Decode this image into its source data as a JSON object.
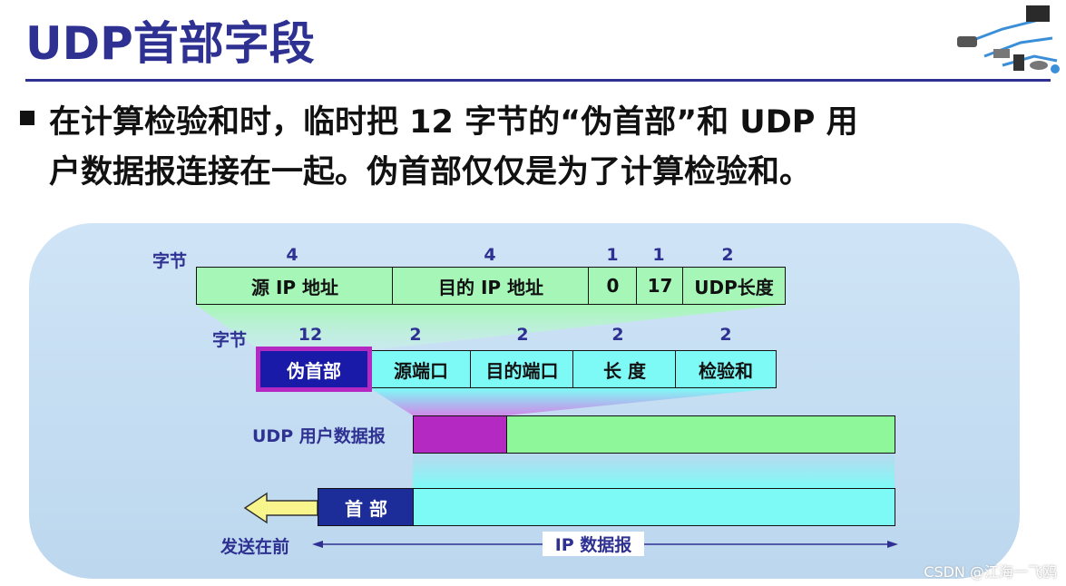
{
  "title": "UDP首部字段",
  "bullet": {
    "line1": "在计算检验和时，临时把 12 字节的“伪首部”和 UDP 用",
    "line2": "户数据报连接在一起。伪首部仅仅是为了计算检验和。"
  },
  "icons": {
    "network": "network-diagram-icon",
    "arrow": "arrow-left-icon",
    "bullet": "square-bullet-icon"
  },
  "pseudo_header": {
    "bytes_label": "字节",
    "byte_counts": [
      "4",
      "4",
      "1",
      "1",
      "2"
    ],
    "fields": [
      "源 IP 地址",
      "目的 IP 地址",
      "0",
      "17",
      "UDP长度"
    ]
  },
  "udp_header": {
    "bytes_label": "字节",
    "byte_counts": [
      "12",
      "2",
      "2",
      "2",
      "2"
    ],
    "fields": [
      "伪首部",
      "源端口",
      "目的端口",
      "长  度",
      "检验和"
    ]
  },
  "udp_datagram_label": "UDP 用户数据报",
  "ip_header_label": "首 部",
  "send_first_label": "发送在前",
  "ip_datagram_label": "IP 数据报",
  "watermark": "CSDN @江海一飞鸥",
  "colors": {
    "title": "#2e3192",
    "pseudo_field": "#a6f7b7",
    "pseudo_box": "#1a1aa8",
    "udp_field": "#7efaf6",
    "purple": "#b529c3",
    "green_body": "#8ef79a",
    "cyan_body": "#7efaf6",
    "ip_header": "#1c2d9a",
    "arrow": "#f9f58d"
  }
}
